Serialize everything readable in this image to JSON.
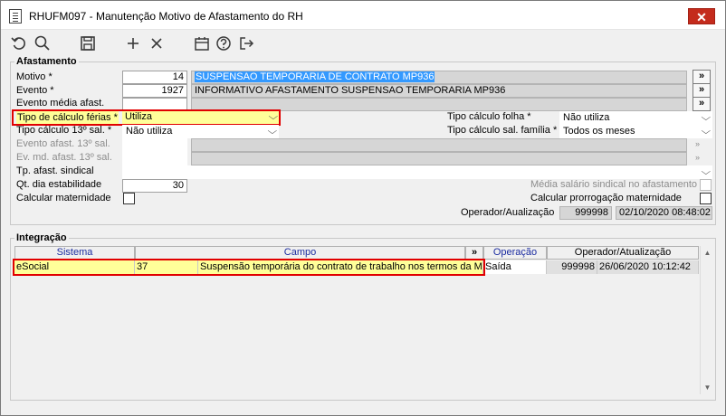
{
  "window": {
    "title": "RHUFM097 - Manutenção Motivo de Afastamento do RH",
    "close_label": "✕"
  },
  "toolbar": {
    "icons": [
      "refresh-icon",
      "search-icon",
      "save-icon",
      "add-icon",
      "delete-icon",
      "calendar-icon",
      "help-icon",
      "exit-icon"
    ]
  },
  "afastamento": {
    "group_title": "Afastamento",
    "motivo": {
      "label": "Motivo *",
      "code": "14",
      "desc": "SUSPENSAO TEMPORARIA DE CONTRATO MP936"
    },
    "evento": {
      "label": "Evento *",
      "code": "1927",
      "desc": "INFORMATIVO AFASTAMENTO SUSPENSAO TEMPORARIA MP936"
    },
    "evento_media": {
      "label": "Evento média afast.",
      "code": "",
      "desc": ""
    },
    "more_button": "»",
    "tipo_calculo_ferias": {
      "label": "Tipo de cálculo férias *",
      "value": "Utiliza"
    },
    "tipo_calculo_13": {
      "label": "Tipo cálculo 13º sal. *",
      "value": "Não utiliza"
    },
    "evento_afast_13": {
      "label": "Evento afast. 13º sal."
    },
    "ev_md_afast_13": {
      "label": "Ev. md. afast. 13º sal."
    },
    "tp_afast_sindical": {
      "label": "Tp. afast. sindical",
      "value": ""
    },
    "qt_dia_estabilidade": {
      "label": "Qt. dia estabilidade",
      "value": "30"
    },
    "calcular_maternidade": {
      "label": "Calcular maternidade"
    },
    "tipo_calculo_folha": {
      "label": "Tipo cálculo folha *",
      "value": "Não utiliza"
    },
    "tipo_calculo_sal_familia": {
      "label": "Tipo cálculo sal. família *",
      "value": "Todos os meses"
    },
    "media_salario_sindical": {
      "label": "Média salário sindical no afastamento"
    },
    "calcular_prorrogacao": {
      "label": "Calcular prorrogação maternidade"
    },
    "operador": {
      "label": "Operador/Aualização",
      "user": "999998",
      "datetime": "02/10/2020 08:48:02"
    }
  },
  "integracao": {
    "group_title": "Integração",
    "columns": {
      "sistema": "Sistema",
      "campo": "Campo",
      "more": "»",
      "operacao": "Operação",
      "operador": "Operador/Atualização"
    },
    "rows": [
      {
        "sistema": "eSocial",
        "campo_code": "37",
        "campo_desc": "Suspensão temporária do contrato de trabalho nos termos da MF",
        "operacao": "Saída",
        "user": "999998",
        "datetime": "26/06/2020 10:12:42"
      }
    ]
  },
  "colors": {
    "highlight_red": "#e10000",
    "selected_blue": "#3399ff",
    "row_yellow": "#ffff99",
    "header_blue": "#1a2ba0"
  }
}
